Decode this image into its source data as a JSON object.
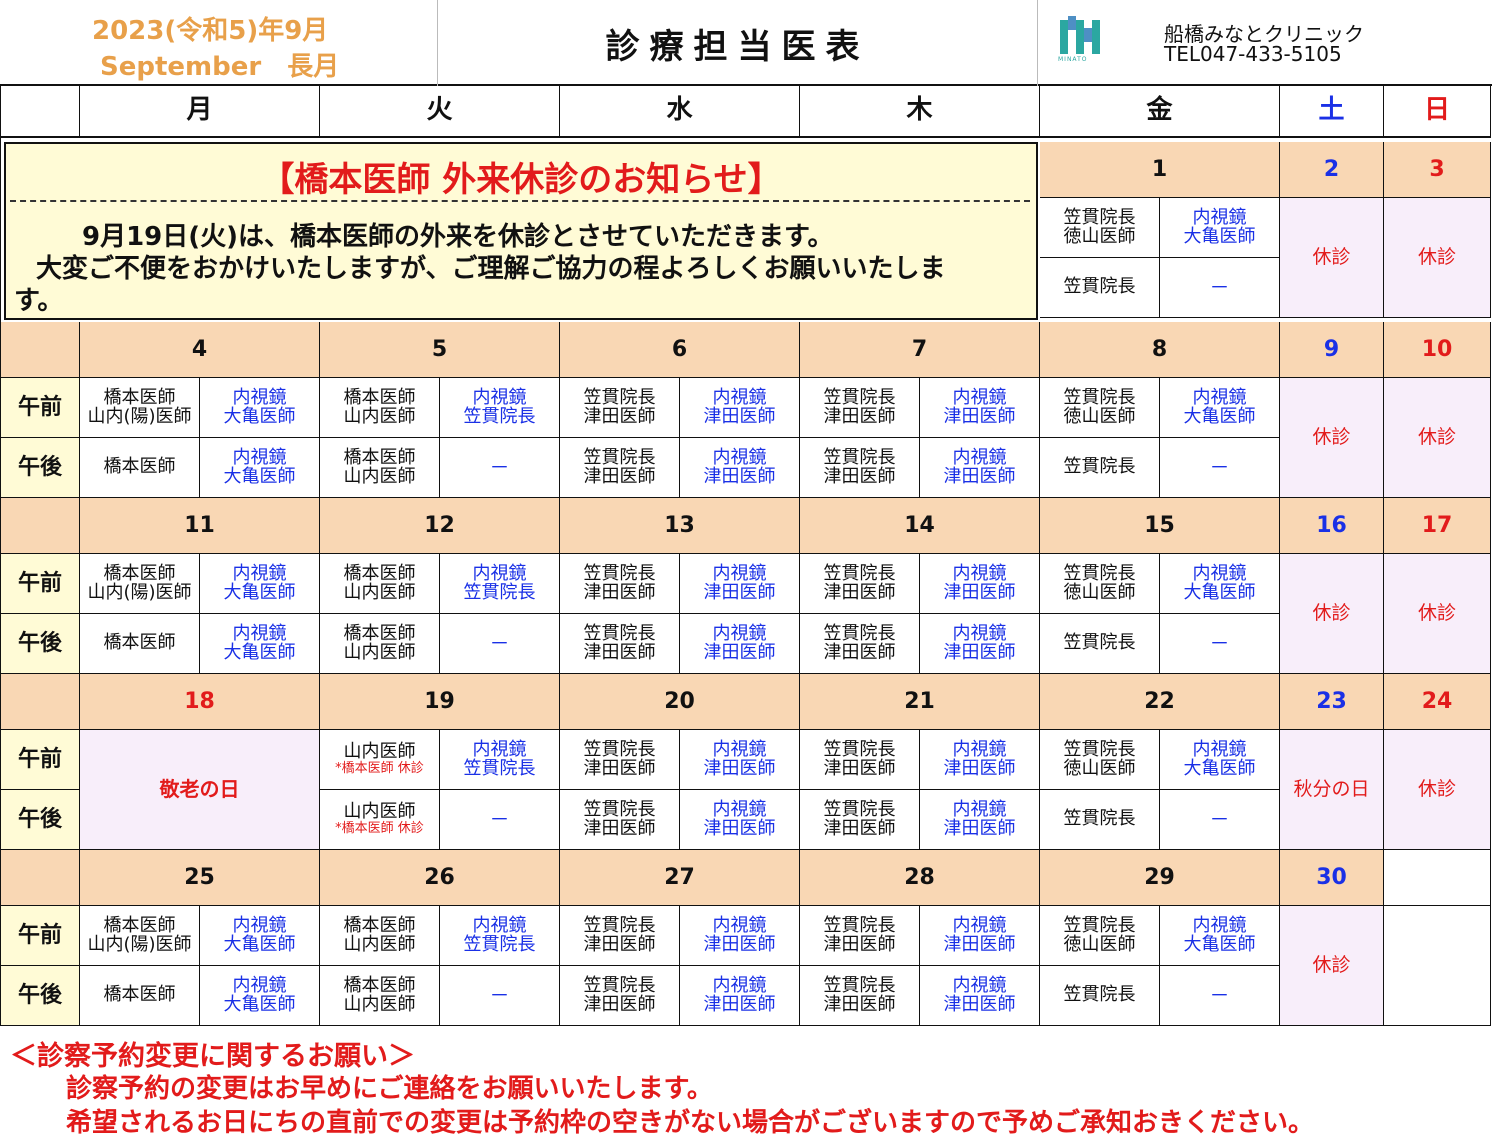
{
  "header": {
    "date_line1": "2023(令和5)年9月",
    "date_line2": "September　長月",
    "title": "診療担当医表",
    "clinic_name": "船橋みなとクリニック",
    "tel": "TEL047-433-5105",
    "logo_text": "MINATO"
  },
  "weekdays": [
    "月",
    "火",
    "水",
    "木",
    "金",
    "土",
    "日"
  ],
  "ampm": {
    "am": "午前",
    "pm": "午後"
  },
  "notice": {
    "title": "【橋本医師 外来休診のお知らせ】",
    "line1": "9月19日(火)は、橋本医師の外来を休診とさせていただきます。",
    "line2": "大変ご不便をおかけいたしますが、ご理解ご協力の程よろしくお願いいたしま",
    "line3": "す。"
  },
  "week1": {
    "days": [
      "1",
      "2",
      "3"
    ],
    "fri_am_l": [
      "笠貫院長",
      "徳山医師"
    ],
    "fri_am_r": [
      "内視鏡",
      "大亀医師"
    ],
    "fri_pm_l": "笠貫院長",
    "fri_pm_r": "－",
    "sat": "休診",
    "sun": "休診"
  },
  "weeks": [
    {
      "days": [
        "4",
        "5",
        "6",
        "7",
        "8",
        "9",
        "10"
      ],
      "mon_am_l": [
        "橋本医師",
        "山内(陽)医師"
      ],
      "mon_am_r": [
        "内視鏡",
        "大亀医師"
      ],
      "mon_pm_l": "橋本医師",
      "mon_pm_r": [
        "内視鏡",
        "大亀医師"
      ],
      "tue_am_l": [
        "橋本医師",
        "山内医師"
      ],
      "tue_am_r": [
        "内視鏡",
        "笠貫院長"
      ],
      "tue_pm_l": [
        "橋本医師",
        "山内医師"
      ],
      "tue_pm_r": "－",
      "wed_am_l": [
        "笠貫院長",
        "津田医師"
      ],
      "wed_am_r": [
        "内視鏡",
        "津田医師"
      ],
      "wed_pm_l": [
        "笠貫院長",
        "津田医師"
      ],
      "wed_pm_r": [
        "内視鏡",
        "津田医師"
      ],
      "thu_am_l": [
        "笠貫院長",
        "津田医師"
      ],
      "thu_am_r": [
        "内視鏡",
        "津田医師"
      ],
      "thu_pm_l": [
        "笠貫院長",
        "津田医師"
      ],
      "thu_pm_r": [
        "内視鏡",
        "津田医師"
      ],
      "fri_am_l": [
        "笠貫院長",
        "徳山医師"
      ],
      "fri_am_r": [
        "内視鏡",
        "大亀医師"
      ],
      "fri_pm_l": "笠貫院長",
      "fri_pm_r": "－",
      "sat": "休診",
      "sun": "休診"
    },
    {
      "days": [
        "11",
        "12",
        "13",
        "14",
        "15",
        "16",
        "17"
      ],
      "mon_am_l": [
        "橋本医師",
        "山内(陽)医師"
      ],
      "mon_am_r": [
        "内視鏡",
        "大亀医師"
      ],
      "mon_pm_l": "橋本医師",
      "mon_pm_r": [
        "内視鏡",
        "大亀医師"
      ],
      "tue_am_l": [
        "橋本医師",
        "山内医師"
      ],
      "tue_am_r": [
        "内視鏡",
        "笠貫院長"
      ],
      "tue_pm_l": [
        "橋本医師",
        "山内医師"
      ],
      "tue_pm_r": "－",
      "wed_am_l": [
        "笠貫院長",
        "津田医師"
      ],
      "wed_am_r": [
        "内視鏡",
        "津田医師"
      ],
      "wed_pm_l": [
        "笠貫院長",
        "津田医師"
      ],
      "wed_pm_r": [
        "内視鏡",
        "津田医師"
      ],
      "thu_am_l": [
        "笠貫院長",
        "津田医師"
      ],
      "thu_am_r": [
        "内視鏡",
        "津田医師"
      ],
      "thu_pm_l": [
        "笠貫院長",
        "津田医師"
      ],
      "thu_pm_r": [
        "内視鏡",
        "津田医師"
      ],
      "fri_am_l": [
        "笠貫院長",
        "徳山医師"
      ],
      "fri_am_r": [
        "内視鏡",
        "大亀医師"
      ],
      "fri_pm_l": "笠貫院長",
      "fri_pm_r": "－",
      "sat": "休診",
      "sun": "休診"
    },
    {
      "days": [
        "18",
        "19",
        "20",
        "21",
        "22",
        "23",
        "24"
      ],
      "mon_holiday": "敬老の日",
      "tue_am_l": [
        "山内医師",
        "*橋本医師 休診"
      ],
      "tue_am_r": [
        "内視鏡",
        "笠貫院長"
      ],
      "tue_pm_l": [
        "山内医師",
        "*橋本医師 休診"
      ],
      "tue_pm_r": "－",
      "wed_am_l": [
        "笠貫院長",
        "津田医師"
      ],
      "wed_am_r": [
        "内視鏡",
        "津田医師"
      ],
      "wed_pm_l": [
        "笠貫院長",
        "津田医師"
      ],
      "wed_pm_r": [
        "内視鏡",
        "津田医師"
      ],
      "thu_am_l": [
        "笠貫院長",
        "津田医師"
      ],
      "thu_am_r": [
        "内視鏡",
        "津田医師"
      ],
      "thu_pm_l": [
        "笠貫院長",
        "津田医師"
      ],
      "thu_pm_r": [
        "内視鏡",
        "津田医師"
      ],
      "fri_am_l": [
        "笠貫院長",
        "徳山医師"
      ],
      "fri_am_r": [
        "内視鏡",
        "大亀医師"
      ],
      "fri_pm_l": "笠貫院長",
      "fri_pm_r": "－",
      "sat": "秋分の日",
      "sun": "休診"
    },
    {
      "days": [
        "25",
        "26",
        "27",
        "28",
        "29",
        "30",
        ""
      ],
      "mon_am_l": [
        "橋本医師",
        "山内(陽)医師"
      ],
      "mon_am_r": [
        "内視鏡",
        "大亀医師"
      ],
      "mon_pm_l": "橋本医師",
      "mon_pm_r": [
        "内視鏡",
        "大亀医師"
      ],
      "tue_am_l": [
        "橋本医師",
        "山内医師"
      ],
      "tue_am_r": [
        "内視鏡",
        "笠貫院長"
      ],
      "tue_pm_l": [
        "橋本医師",
        "山内医師"
      ],
      "tue_pm_r": "－",
      "wed_am_l": [
        "笠貫院長",
        "津田医師"
      ],
      "wed_am_r": [
        "内視鏡",
        "津田医師"
      ],
      "wed_pm_l": [
        "笠貫院長",
        "津田医師"
      ],
      "wed_pm_r": [
        "内視鏡",
        "津田医師"
      ],
      "thu_am_l": [
        "笠貫院長",
        "津田医師"
      ],
      "thu_am_r": [
        "内視鏡",
        "津田医師"
      ],
      "thu_pm_l": [
        "笠貫院長",
        "津田医師"
      ],
      "thu_pm_r": [
        "内視鏡",
        "津田医師"
      ],
      "fri_am_l": [
        "笠貫院長",
        "徳山医師"
      ],
      "fri_am_r": [
        "内視鏡",
        "大亀医師"
      ],
      "fri_pm_l": "笠貫院長",
      "fri_pm_r": "－",
      "sat": "休診"
    }
  ],
  "footer": {
    "title": "＜診察予約変更に関するお願い＞",
    "line1": "診察予約の変更はお早めにご連絡をお願いいたします。",
    "line2": "希望されるお日にちの直前での変更は予約枠の空きがない場合がございますので予めご承知おきください。"
  },
  "colors": {
    "orange_header": "#f9d7b4",
    "pink_closed": "#f8eefa",
    "cream_notice": "#fffbd6",
    "blue_text": "#1a30e6",
    "red_text": "#e21b1b",
    "date_orange": "#e8a04a"
  }
}
